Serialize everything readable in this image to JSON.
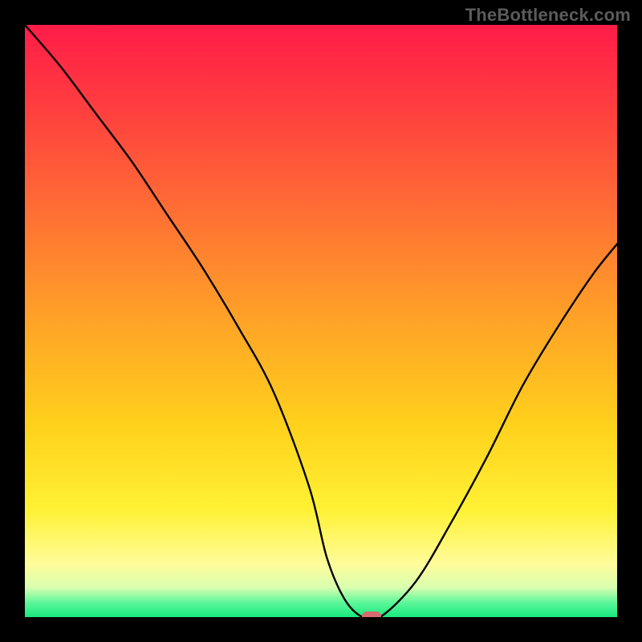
{
  "watermark": "TheBottleneck.com",
  "chart_data": {
    "type": "line",
    "title": "",
    "xlabel": "",
    "ylabel": "",
    "xlim": [
      0,
      100
    ],
    "ylim": [
      0,
      100
    ],
    "grid": false,
    "series": [
      {
        "name": "curve",
        "x": [
          0,
          6,
          12,
          18,
          24,
          30,
          36,
          42,
          48,
          51,
          54,
          57,
          60,
          66,
          72,
          78,
          84,
          90,
          96,
          100
        ],
        "values": [
          100,
          93,
          85,
          77,
          68,
          59,
          49,
          38,
          22,
          10,
          3,
          0,
          0,
          6,
          16,
          27,
          39,
          49,
          58,
          63
        ]
      }
    ],
    "marker": {
      "x": 58.5,
      "y": 0
    },
    "background_gradient_top": "#ff1c48",
    "background_gradient_bottom": "#18e87d"
  }
}
